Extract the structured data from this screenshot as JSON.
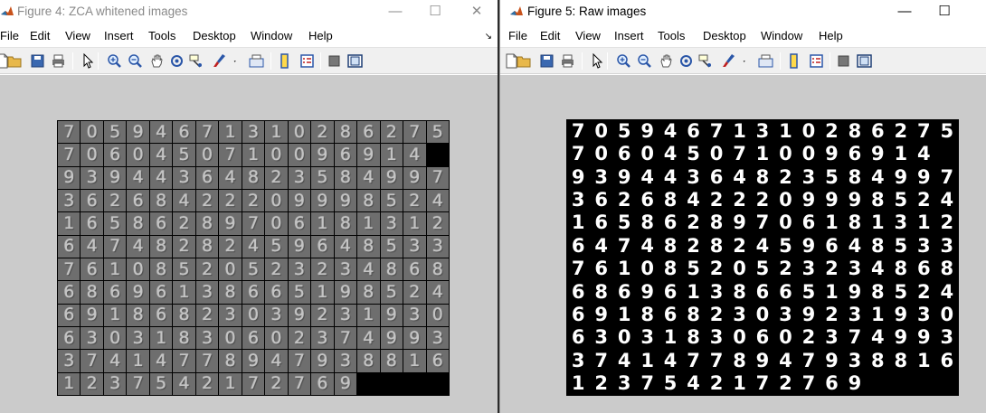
{
  "windows": [
    {
      "title": "Figure 4: ZCA whitened images",
      "active": false,
      "menu": [
        "File",
        "Edit",
        "View",
        "Insert",
        "Tools",
        "Desktop",
        "Window",
        "Help"
      ],
      "controls": {
        "minimize": "—",
        "maximize": "☐",
        "close": "✕"
      },
      "menu_overflow": "↘",
      "toolbar_icons": [
        "new-figure-icon",
        "open-file-icon",
        "save-icon",
        "print-icon",
        "pointer-icon",
        "zoom-in-icon",
        "zoom-out-icon",
        "pan-icon",
        "rotate-3d-icon",
        "data-cursor-icon",
        "brush-icon",
        "brush-dropdown-icon",
        "link-plot-icon",
        "colorbar-icon",
        "legend-icon",
        "hide-plot-tools-icon",
        "show-plot-tools-icon"
      ],
      "image_style": "zca"
    },
    {
      "title": "Figure 5: Raw images",
      "active": true,
      "menu": [
        "File",
        "Edit",
        "View",
        "Insert",
        "Tools",
        "Desktop",
        "Window",
        "Help"
      ],
      "controls": {
        "minimize": "—",
        "maximize": "☐",
        "close": "✕"
      },
      "menu_overflow": "",
      "toolbar_icons": [
        "new-figure-icon",
        "open-file-icon",
        "save-icon",
        "print-icon",
        "pointer-icon",
        "zoom-in-icon",
        "zoom-out-icon",
        "pan-icon",
        "rotate-3d-icon",
        "data-cursor-icon",
        "brush-icon",
        "brush-dropdown-icon",
        "link-plot-icon",
        "colorbar-icon",
        "legend-icon",
        "hide-plot-tools-icon",
        "show-plot-tools-icon"
      ],
      "image_style": "raw"
    }
  ],
  "digit_grid": {
    "columns": 17,
    "rows": [
      [
        "7",
        "0",
        "5",
        "9",
        "4",
        "6",
        "7",
        "1",
        "3",
        "1",
        "0",
        "2",
        "8",
        "6",
        "2",
        "7",
        "5"
      ],
      [
        "7",
        "0",
        "6",
        "0",
        "4",
        "5",
        "0",
        "7",
        "1",
        "0",
        "0",
        "9",
        "6",
        "9",
        "1",
        "4"
      ],
      [
        "9",
        "3",
        "9",
        "4",
        "4",
        "3",
        "6",
        "4",
        "8",
        "2",
        "3",
        "5",
        "8",
        "4",
        "9",
        "9",
        "7"
      ],
      [
        "3",
        "6",
        "2",
        "6",
        "8",
        "4",
        "2",
        "2",
        "2",
        "0",
        "9",
        "9",
        "9",
        "8",
        "5",
        "2",
        "4"
      ],
      [
        "1",
        "6",
        "5",
        "8",
        "6",
        "2",
        "8",
        "9",
        "7",
        "0",
        "6",
        "1",
        "8",
        "1",
        "3",
        "1",
        "2"
      ],
      [
        "6",
        "4",
        "7",
        "4",
        "8",
        "2",
        "8",
        "2",
        "4",
        "5",
        "9",
        "6",
        "4",
        "8",
        "5",
        "3",
        "3"
      ],
      [
        "7",
        "6",
        "1",
        "0",
        "8",
        "5",
        "2",
        "0",
        "5",
        "2",
        "3",
        "2",
        "3",
        "4",
        "8",
        "6",
        "8"
      ],
      [
        "6",
        "8",
        "6",
        "9",
        "6",
        "1",
        "3",
        "8",
        "6",
        "6",
        "5",
        "1",
        "9",
        "8",
        "5",
        "2",
        "4"
      ],
      [
        "6",
        "9",
        "1",
        "8",
        "6",
        "8",
        "2",
        "3",
        "0",
        "3",
        "9",
        "2",
        "3",
        "1",
        "9",
        "3",
        "0"
      ],
      [
        "6",
        "3",
        "0",
        "3",
        "1",
        "8",
        "3",
        "0",
        "6",
        "0",
        "2",
        "3",
        "7",
        "4",
        "9",
        "9",
        "3"
      ],
      [
        "3",
        "7",
        "4",
        "1",
        "4",
        "7",
        "7",
        "8",
        "9",
        "4",
        "7",
        "9",
        "3",
        "8",
        "8",
        "1",
        "6"
      ],
      [
        "1",
        "2",
        "3",
        "7",
        "5",
        "4",
        "2",
        "1",
        "7",
        "2",
        "7",
        "6",
        "9"
      ]
    ]
  },
  "colors": {
    "canvas_bg": "#cbcbcb",
    "zca_cell_bg": "#6e6e6e",
    "raw_cell_bg": "#000000",
    "title_inactive": "#8a8a8a"
  }
}
